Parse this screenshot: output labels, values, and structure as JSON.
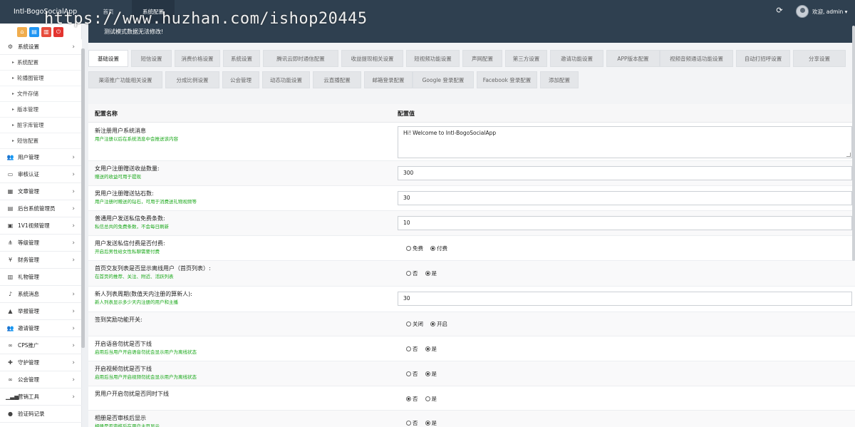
{
  "topbar": {
    "brand": "Intl-BogoSocialApp",
    "nav": [
      {
        "label": "首页"
      },
      {
        "label": "系统配置"
      }
    ],
    "welcome": "欢迎, admin ▾"
  },
  "watermark": "https://www.huzhan.com/ishop20445",
  "notice": "测试模式数据无法修改!",
  "sidebar": {
    "open_section": {
      "label": "系统设置"
    },
    "sub_items": [
      {
        "label": "系统配置"
      },
      {
        "label": "轮播图管理"
      },
      {
        "label": "文件存储"
      },
      {
        "label": "版本管理"
      },
      {
        "label": "脏字库管理"
      },
      {
        "label": "短信配置"
      }
    ],
    "sections": [
      {
        "label": "用户管理",
        "icon": "users-icon",
        "glyph": "👥",
        "arrow": true
      },
      {
        "label": "审核认证",
        "icon": "id-card-icon",
        "glyph": "▭",
        "arrow": true
      },
      {
        "label": "文章管理",
        "icon": "grid-icon",
        "glyph": "▦",
        "arrow": true
      },
      {
        "label": "后台系统管理员",
        "icon": "admin-card-icon",
        "glyph": "▤",
        "arrow": true
      },
      {
        "label": "1V1视频管理",
        "icon": "video-file-icon",
        "glyph": "▣",
        "arrow": true
      },
      {
        "label": "等级管理",
        "icon": "hierarchy-icon",
        "glyph": "⋔",
        "arrow": true
      },
      {
        "label": "财务管理",
        "icon": "yen-icon",
        "glyph": "¥",
        "arrow": true
      },
      {
        "label": "礼物管理",
        "icon": "gift-icon",
        "glyph": "▥",
        "arrow": false
      },
      {
        "label": "系统消息",
        "icon": "bell-icon",
        "glyph": "♪",
        "arrow": true
      },
      {
        "label": "举报管理",
        "icon": "warning-icon",
        "glyph": "▲",
        "arrow": true
      },
      {
        "label": "邀请管理",
        "icon": "group-icon",
        "glyph": "👥",
        "arrow": true
      },
      {
        "label": "CPS推广",
        "icon": "handshake-icon",
        "glyph": "∞",
        "arrow": true
      },
      {
        "label": "守护管理",
        "icon": "medal-icon",
        "glyph": "✚",
        "arrow": true
      },
      {
        "label": "公会管理",
        "icon": "guild-icon",
        "glyph": "∞",
        "arrow": true
      },
      {
        "label": "营销工具",
        "icon": "bar-chart-icon",
        "glyph": "▁▃▅",
        "arrow": true
      },
      {
        "label": "验证码记录",
        "icon": "chat-icon",
        "glyph": "●",
        "arrow": false
      }
    ]
  },
  "tabs": [
    {
      "label": "基础设置",
      "active": true
    },
    {
      "label": "短信设置"
    },
    {
      "label": "消费价格设置"
    },
    {
      "label": "系统设置"
    },
    {
      "label": "腾讯云即时通信配置"
    },
    {
      "label": "收益提现相关设置"
    },
    {
      "label": "短视频功能设置"
    },
    {
      "label": "声网配置"
    },
    {
      "label": "第三方设置"
    },
    {
      "label": "邀请功能设置"
    },
    {
      "label": "APP版本配置"
    },
    {
      "label": "视频音频通话功能设置"
    },
    {
      "label": "自动打招呼设置"
    },
    {
      "label": "分享设置"
    },
    {
      "label": "渠道推广功能相关设置"
    },
    {
      "label": "分成比例设置"
    },
    {
      "label": "公会管理"
    },
    {
      "label": "动态功能设置"
    },
    {
      "label": "云直播配置"
    },
    {
      "label": "邮箱登录配置"
    },
    {
      "label": "Google 登录配置"
    },
    {
      "label": "Facebook 登录配置"
    },
    {
      "label": "添加配置"
    }
  ],
  "table": {
    "col_name": "配置名称",
    "col_value": "配置值",
    "rows": [
      {
        "name": "新注册用户系统消息",
        "desc": "用户注册以后在系统消息中会推送该内容",
        "type": "textarea",
        "value": "Hi! Welcome to Intl-BogoSocialApp"
      },
      {
        "name": "女用户注册赠送收益数量:",
        "desc": "赠送的收益可用于提现",
        "type": "input",
        "value": "300"
      },
      {
        "name": "男用户注册赠送钻石数:",
        "desc": "用户注册时赠送的钻石，可用于消费送礼物视频等",
        "type": "input",
        "value": "30"
      },
      {
        "name": "普通用户发送私信免费条数:",
        "desc": "私信总共的免费条数，不会每日刷新",
        "type": "input",
        "value": "10"
      },
      {
        "name": "用户发送私信付费是否付费:",
        "desc": "开启后男性给女性私聊需要付费",
        "type": "radio",
        "options": [
          {
            "label": "免费",
            "checked": false
          },
          {
            "label": "付费",
            "checked": true
          }
        ]
      },
      {
        "name": "首页交友列表是否显示离线用户（首页列表）:",
        "desc": "在首页的推荐、关注、附近、活跃列表",
        "type": "radio",
        "options": [
          {
            "label": "否",
            "checked": false
          },
          {
            "label": "是",
            "checked": true
          }
        ]
      },
      {
        "name": "新人列表周期(数值天内注册的算新人):",
        "desc": "新人列表显示多少天内注册的用户和主播",
        "type": "input",
        "value": "30"
      },
      {
        "name": "签到奖励功能开关:",
        "desc": "",
        "type": "radio",
        "options": [
          {
            "label": "关闭",
            "checked": false
          },
          {
            "label": "开启",
            "checked": true
          }
        ]
      },
      {
        "name": "开启语音勿扰是否下线",
        "desc": "启用后当用户开启语音勿扰会显示用户为离线状态",
        "type": "radio",
        "options": [
          {
            "label": "否",
            "checked": false
          },
          {
            "label": "是",
            "checked": true
          }
        ]
      },
      {
        "name": "开启视频勿扰是否下线",
        "desc": "启用后当用户开启视频勿扰会显示用户为离线状态",
        "type": "radio",
        "options": [
          {
            "label": "否",
            "checked": false
          },
          {
            "label": "是",
            "checked": true
          }
        ]
      },
      {
        "name": "男用户开启勿扰是否同时下线",
        "desc": "",
        "type": "radio",
        "options": [
          {
            "label": "否",
            "checked": true
          },
          {
            "label": "是",
            "checked": false
          }
        ]
      },
      {
        "name": "相册是否审核后显示",
        "desc": "相册是否审核后在用户主页显示",
        "type": "radio",
        "options": [
          {
            "label": "否",
            "checked": false
          },
          {
            "label": "是",
            "checked": true
          }
        ]
      }
    ]
  }
}
